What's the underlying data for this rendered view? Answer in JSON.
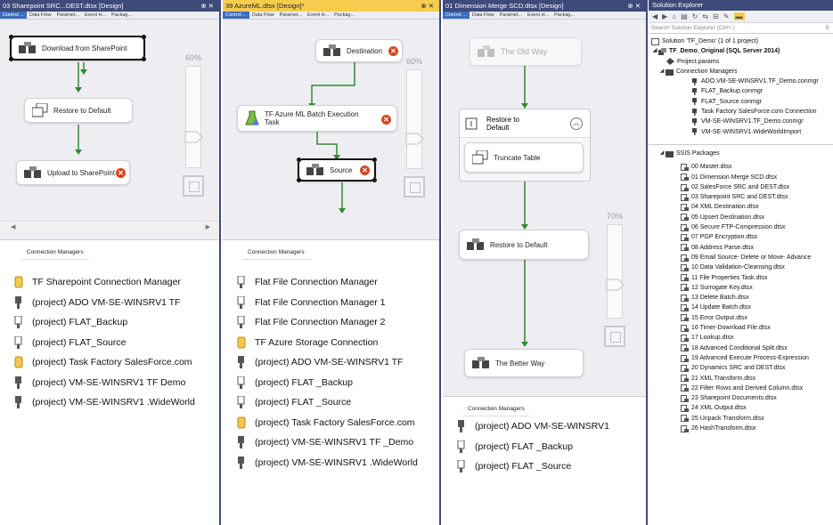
{
  "panes": [
    {
      "tab_title": "03 Sharepoint SRC...DEST.dtsx [Design]",
      "subtabs": [
        "Control ...",
        "Data Flow",
        "Paramet...",
        "Event H...",
        "Packag..."
      ],
      "zoom": "60%",
      "tasks": [
        {
          "label": "Download from SharePoint",
          "selected": true,
          "error": false
        },
        {
          "label": "Restore to Default",
          "selected": false,
          "error": false
        },
        {
          "label": "Upload to SharePoint",
          "selected": false,
          "error": true
        }
      ],
      "conn_tab": "Connection Managers",
      "connections": [
        {
          "icon": "azure-storage-icon",
          "label": "TF Sharepoint Connection Manager"
        },
        {
          "icon": "database-plug-icon",
          "label": "(project) ADO VM-SE-WINSRV1 TF"
        },
        {
          "icon": "flat-file-icon",
          "label": "(project) FLAT_Backup"
        },
        {
          "icon": "flat-file-icon",
          "label": "(project) FLAT_Source"
        },
        {
          "icon": "azure-storage-icon",
          "label": "(project) Task Factory SalesForce.com"
        },
        {
          "icon": "database-plug-icon",
          "label": "(project) VM-SE-WINSRV1 TF Demo"
        },
        {
          "icon": "database-plug-icon",
          "label": "(project) VM-SE-WINSRV1 .WideWorld"
        }
      ]
    },
    {
      "tab_title": "39 AzureML.dtsx [Design]*",
      "subtabs": [
        "Control ...",
        "Data Flow",
        "Paramet...",
        "Event H...",
        "Packag..."
      ],
      "zoom": "60%",
      "tasks": [
        {
          "label": "Destination",
          "selected": false,
          "error": true
        },
        {
          "label": "TF Azure ML Batch Execution Task",
          "selected": false,
          "error": true
        },
        {
          "label": "Source",
          "selected": true,
          "error": true
        }
      ],
      "conn_tab": "Connection Managers",
      "connections": [
        {
          "icon": "flat-file-icon",
          "label": "Flat File Connection Manager"
        },
        {
          "icon": "flat-file-icon",
          "label": "Flat File Connection Manager 1"
        },
        {
          "icon": "flat-file-icon",
          "label": "Flat File Connection Manager 2"
        },
        {
          "icon": "azure-storage-icon",
          "label": "TF Azure Storage Connection"
        },
        {
          "icon": "database-plug-icon",
          "label": "(project) ADO VM-SE-WINSRV1 TF"
        },
        {
          "icon": "flat-file-icon",
          "label": "(project) FLAT _Backup"
        },
        {
          "icon": "flat-file-icon",
          "label": "(project) FLAT _Source"
        },
        {
          "icon": "azure-storage-icon",
          "label": "(project) Task Factory SalesForce.com"
        },
        {
          "icon": "database-plug-icon",
          "label": "(project) VM-SE-WINSRV1 TF _Demo"
        },
        {
          "icon": "database-plug-icon",
          "label": "(project) VM-SE-WINSRV1 .WideWorld"
        }
      ]
    },
    {
      "tab_title": "01 Dimension Merge SCD.dtsx [Design]",
      "subtabs": [
        "Control ...",
        "Data Flow",
        "Paramet...",
        "Event H...",
        "Packag..."
      ],
      "zoom": "70%",
      "tasks": [
        {
          "label": "The Old Way",
          "selected": false,
          "error": false
        },
        {
          "label": "Restore to Default",
          "selected": false,
          "error": false
        },
        {
          "label": "Truncate Table",
          "selected": false,
          "error": false
        },
        {
          "label": "Restore to Default",
          "selected": false,
          "error": false
        },
        {
          "label": "The Better Way",
          "selected": false,
          "error": false
        }
      ],
      "conn_tab": "Connection Managers",
      "connections": [
        {
          "icon": "database-plug-icon",
          "label": "(project) ADO VM-SE-WINSRV1"
        },
        {
          "icon": "flat-file-icon",
          "label": "(project) FLAT _Backup"
        },
        {
          "icon": "flat-file-icon",
          "label": "(project) FLAT _Source"
        }
      ]
    }
  ],
  "solution_explorer": {
    "title": "Solution Explorer",
    "search_placeholder": "Search Solution Explorer (Ctrl+;)",
    "solution": "Solution 'TF_Demo' (1 of 1 project)",
    "project": "TF_Demo_Original (SQL Server 2014)",
    "project_params": "Project.params",
    "connection_managers_label": "Connection Managers",
    "connection_managers": [
      "ADO.VM-SE-WINSRV1.TF_Demo.conmgr",
      "FLAT_Backup.conmgr",
      "FLAT_Source.conmgr",
      "Task Factory SalesForce.com Connection",
      "VM-SE-WINSRV1.TF_Demo.conmgr",
      "VM-SE-WINSRV1.WideWorldImport"
    ],
    "packages_label": "SSIS Packages",
    "packages": [
      "00 Master.dtsx",
      "01 Dimension Merge SCD.dtsx",
      "02 SalesForce SRC and DEST.dtsx",
      "03 Sharepoint SRC and DEST.dtsx",
      "04 XML Destination.dtsx",
      "05 Upsert Destination.dtsx",
      "06 Secure FTP-Compression.dtsx",
      "07 PGP Encryption.dtsx",
      "08 Address Parse.dtsx",
      "09 Email Source- Delete or Move- Advance",
      "10 Data Validation-Cleansing.dtsx",
      "11 File Properties Task.dtsx",
      "12 Surrogate Key.dtsx",
      "13 Delete Batch.dtsx",
      "14 Update Batch.dtsx",
      "15 Error Output.dtsx",
      "16 Timer-Download File.dtsx",
      "17 Lookup.dtsx",
      "18 Advanced Conditional Split.dtsx",
      "19 Advanced Execute Process-Expression",
      "20 Dynamics SRC and DEST.dtsx",
      "21 XML Transform.dtsx",
      "22 Filter Rows and Derived Column.dtsx",
      "23 Sharepoint Documents.dtsx",
      "24 XML Output.dtsx",
      "25 Unpack Transform.dtsx",
      "26 HashTransform.dtsx"
    ]
  },
  "colors": {
    "connector": "#2e8b2e",
    "error": "#d9431e",
    "active_tab": "#f5cc4e",
    "chrome": "#3d4a7a"
  }
}
